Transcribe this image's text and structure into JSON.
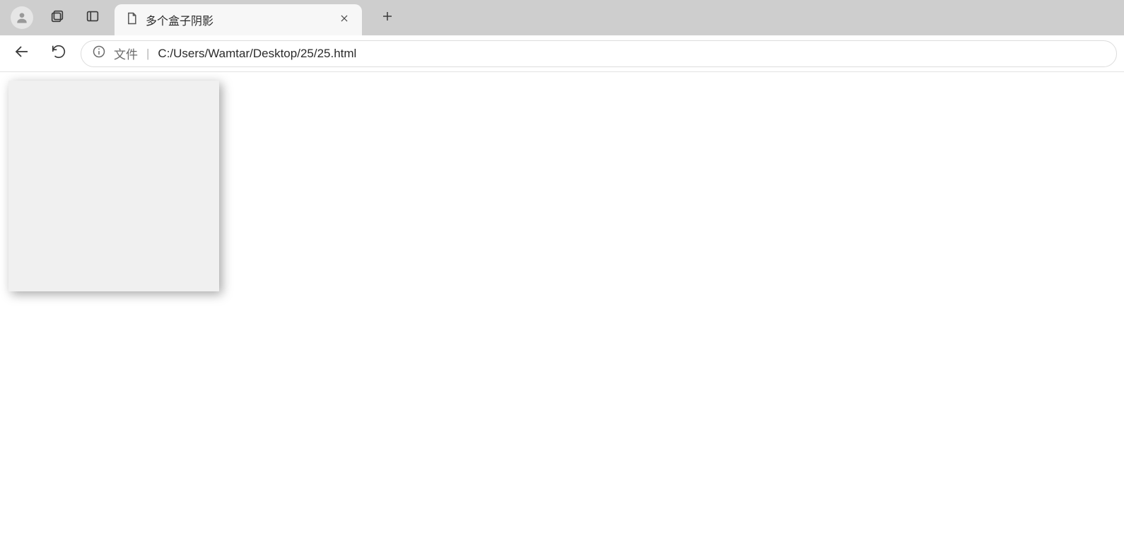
{
  "tab": {
    "title": "多个盒子阴影"
  },
  "address": {
    "prefix": "文件",
    "separator": "|",
    "path": "C:/Users/Wamtar/Desktop/25/25.html"
  },
  "icons": {
    "profile": "profile-icon",
    "collections": "collections-icon",
    "sidebar": "sidebar-icon",
    "page": "page-icon",
    "close": "close-icon",
    "newtab": "plus-icon",
    "back": "back-arrow-icon",
    "reload": "reload-icon",
    "info": "info-icon"
  }
}
